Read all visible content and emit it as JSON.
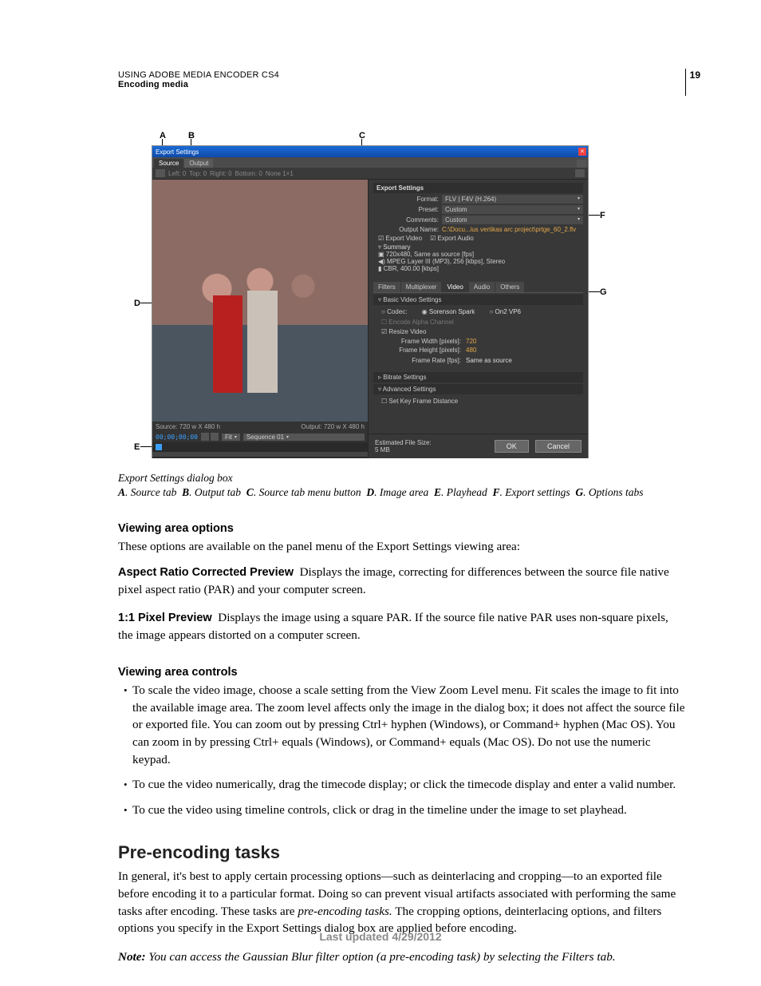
{
  "header": {
    "line1": "USING ADOBE MEDIA ENCODER CS4",
    "line2": "Encoding media",
    "pageNumber": "19"
  },
  "figure": {
    "callouts": {
      "A": "A",
      "B": "B",
      "C": "C",
      "D": "D",
      "E": "E",
      "F": "F",
      "G": "G"
    },
    "titlebar": "Export Settings",
    "closeGlyph": "×",
    "tabs": {
      "source": "Source",
      "output": "Output"
    },
    "cropRow": {
      "left": "Left: 0",
      "top": "Top: 0",
      "right": "Right: 0",
      "bottom": "Bottom: 0",
      "none": "None 1×1"
    },
    "status": {
      "source": "Source: 720 w X 480 h",
      "output": "Output: 720 w X 480 h"
    },
    "timerow": {
      "timecode": "00;00;00;00",
      "fit": "Fit",
      "seq": "Sequence 01"
    },
    "export": {
      "header": "Export Settings",
      "formatLabel": "Format:",
      "formatValue": "FLV | F4V (H.264)",
      "presetLabel": "Preset:",
      "presetValue": "Custom",
      "commentsLabel": "Comments:",
      "commentsValue": "Custom",
      "outputNameLabel": "Output Name:",
      "outputNameValue": "C:\\Docu...ius vertikas arc project\\prtge_60_2.flv",
      "exportVideo": "Export Video",
      "exportAudio": "Export Audio",
      "summaryLabel": "Summary",
      "sumLine1": "▣ 720x480, Same as source [fps]",
      "sumLine2": "◀) MPEG Layer III (MP3), 256 [kbps], Stereo",
      "sumLine3": "▮ CBR, 400.00 [kbps]"
    },
    "optionTabs": [
      "Filters",
      "Multiplexer",
      "Video",
      "Audio",
      "Others"
    ],
    "basic": {
      "header": "Basic Video Settings",
      "codecLabel": "Codec:",
      "codecA": "Sorenson Spark",
      "codecB": "On2 VP6",
      "alpha": "Encode Alpha Channel",
      "resize": "Resize Video",
      "fwLabel": "Frame Width [pixels]:",
      "fwVal": "720",
      "fhLabel": "Frame Height [pixels]:",
      "fhVal": "480",
      "frLabel": "Frame Rate [fps]:",
      "frVal": "Same as source"
    },
    "bitrateHeader": "Bitrate Settings",
    "advHeader": "Advanced Settings",
    "advOpt": "Set Key Frame Distance",
    "estLabel": "Estimated File Size:",
    "estVal": "5 MB",
    "okLabel": "OK",
    "cancelLabel": "Cancel"
  },
  "caption": {
    "title": "Export Settings dialog box",
    "legend": {
      "A": "Source tab",
      "B": "Output tab",
      "C": "Source tab menu button",
      "D": "Image area",
      "E": "Playhead",
      "F": "Export settings",
      "G": "Options tabs"
    }
  },
  "sections": {
    "viewingOptionsHead": "Viewing area options",
    "viewingOptionsIntro": "These options are available on the panel menu of the Export Settings viewing area:",
    "arcpTerm": "Aspect Ratio Corrected Preview",
    "arcpBody": "Displays the image, correcting for differences between the source file native pixel aspect ratio (PAR) and your computer screen.",
    "ppTerm": "1:1 Pixel Preview",
    "ppBody": "Displays the image using a square PAR. If the source file native PAR uses non-square pixels, the image appears distorted on a computer screen.",
    "controlsHead": "Viewing area controls",
    "b1": "To scale the video image, choose a scale setting from the View Zoom Level menu. Fit scales the image to fit into the available image area. The zoom level affects only the image in the dialog box; it does not affect the source file or exported file. You can zoom out by pressing Ctrl+ hyphen (Windows), or Command+ hyphen (Mac OS). You can zoom in by pressing Ctrl+ equals (Windows), or Command+ equals (Mac OS). Do not use the numeric keypad.",
    "b2": "To cue the video numerically, drag the timecode display; or click the timecode display and enter a valid number.",
    "b3": "To cue the video using timeline controls, click or drag in the timeline under the image to set playhead.",
    "preHead": "Pre-encoding tasks",
    "preBody1a": "In general, it's best to apply certain processing options—such as deinterlacing and cropping—to an exported file before encoding it to a particular format. Doing so can prevent visual artifacts associated with performing the same tasks after encoding. These tasks are ",
    "preBody1i": "pre-encoding tasks.",
    "preBody1b": " The cropping options, deinterlacing options, and filters options you specify in the Export Settings dialog box are applied before encoding.",
    "noteLabel": "Note:",
    "noteBody": "You can access the Gaussian Blur filter option (a pre-encoding task) by selecting the Filters tab."
  },
  "footer": "Last updated 4/29/2012"
}
